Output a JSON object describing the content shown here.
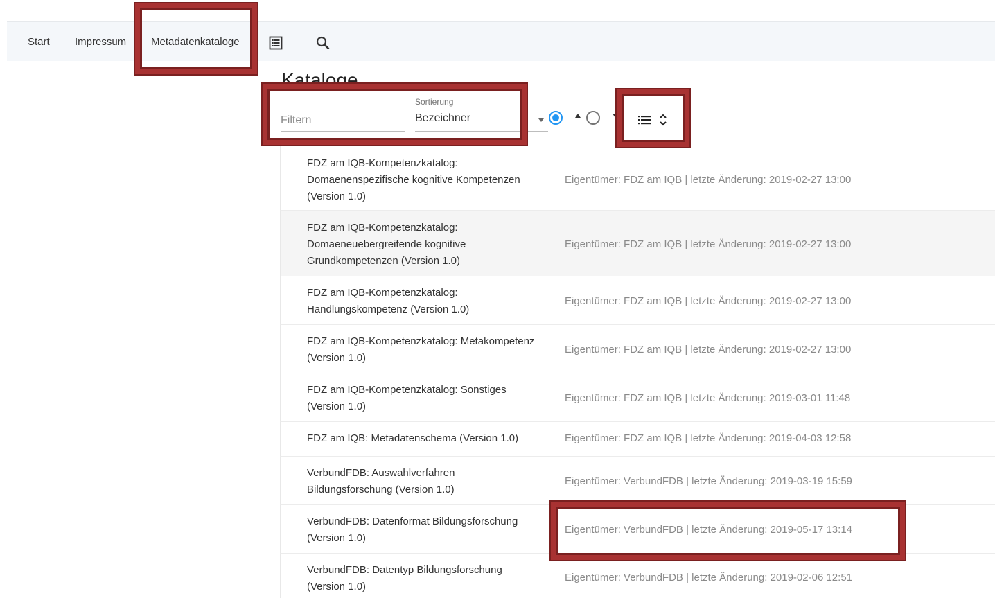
{
  "nav": {
    "start": "Start",
    "impressum": "Impressum",
    "metadatenkataloge": "Metadatenkataloge",
    "list_icon": "list-view-icon",
    "search_icon": "search-icon"
  },
  "page_title": "Kataloge",
  "toolbar": {
    "filter_placeholder": "Filtern",
    "sort_label": "Sortierung",
    "sort_value": "Bezeichner",
    "sort_ascending_selected": true,
    "view_icon": "list-view-icon",
    "expand_icon": "unfold-icon"
  },
  "catalogs": [
    {
      "title": "FDZ am IQB-Kompetenzkatalog: Domaenenspezifische kognitive Kompetenzen (Version 1.0)",
      "meta": "Eigentümer: FDZ am IQB | letzte Änderung: 2019-02-27 13:00"
    },
    {
      "title": "FDZ am IQB-Kompetenzkatalog: Domaeneuebergreifende kognitive Grundkompetenzen (Version 1.0)",
      "meta": "Eigentümer: FDZ am IQB | letzte Änderung: 2019-02-27 13:00"
    },
    {
      "title": "FDZ am IQB-Kompetenzkatalog: Handlungskompetenz (Version 1.0)",
      "meta": "Eigentümer: FDZ am IQB | letzte Änderung: 2019-02-27 13:00"
    },
    {
      "title": "FDZ am IQB-Kompetenzkatalog: Metakompetenz (Version 1.0)",
      "meta": "Eigentümer: FDZ am IQB | letzte Änderung: 2019-02-27 13:00"
    },
    {
      "title": "FDZ am IQB-Kompetenzkatalog: Sonstiges (Version 1.0)",
      "meta": "Eigentümer: FDZ am IQB | letzte Änderung: 2019-03-01 11:48"
    },
    {
      "title": "FDZ am IQB: Metadatenschema (Version 1.0)",
      "meta": "Eigentümer: FDZ am IQB | letzte Änderung: 2019-04-03 12:58"
    },
    {
      "title": "VerbundFDB: Auswahlverfahren Bildungsforschung (Version 1.0)",
      "meta": "Eigentümer: VerbundFDB | letzte Änderung: 2019-03-19 15:59"
    },
    {
      "title": "VerbundFDB: Datenformat Bildungsforschung (Version 1.0)",
      "meta": "Eigentümer: VerbundFDB | letzte Änderung: 2019-05-17 13:14"
    },
    {
      "title": "VerbundFDB: Datentyp Bildungsforschung (Version 1.0)",
      "meta": "Eigentümer: VerbundFDB | letzte Änderung: 2019-02-06 12:51"
    }
  ],
  "colors": {
    "highlight": "#a83232",
    "accent": "#2196f3"
  }
}
